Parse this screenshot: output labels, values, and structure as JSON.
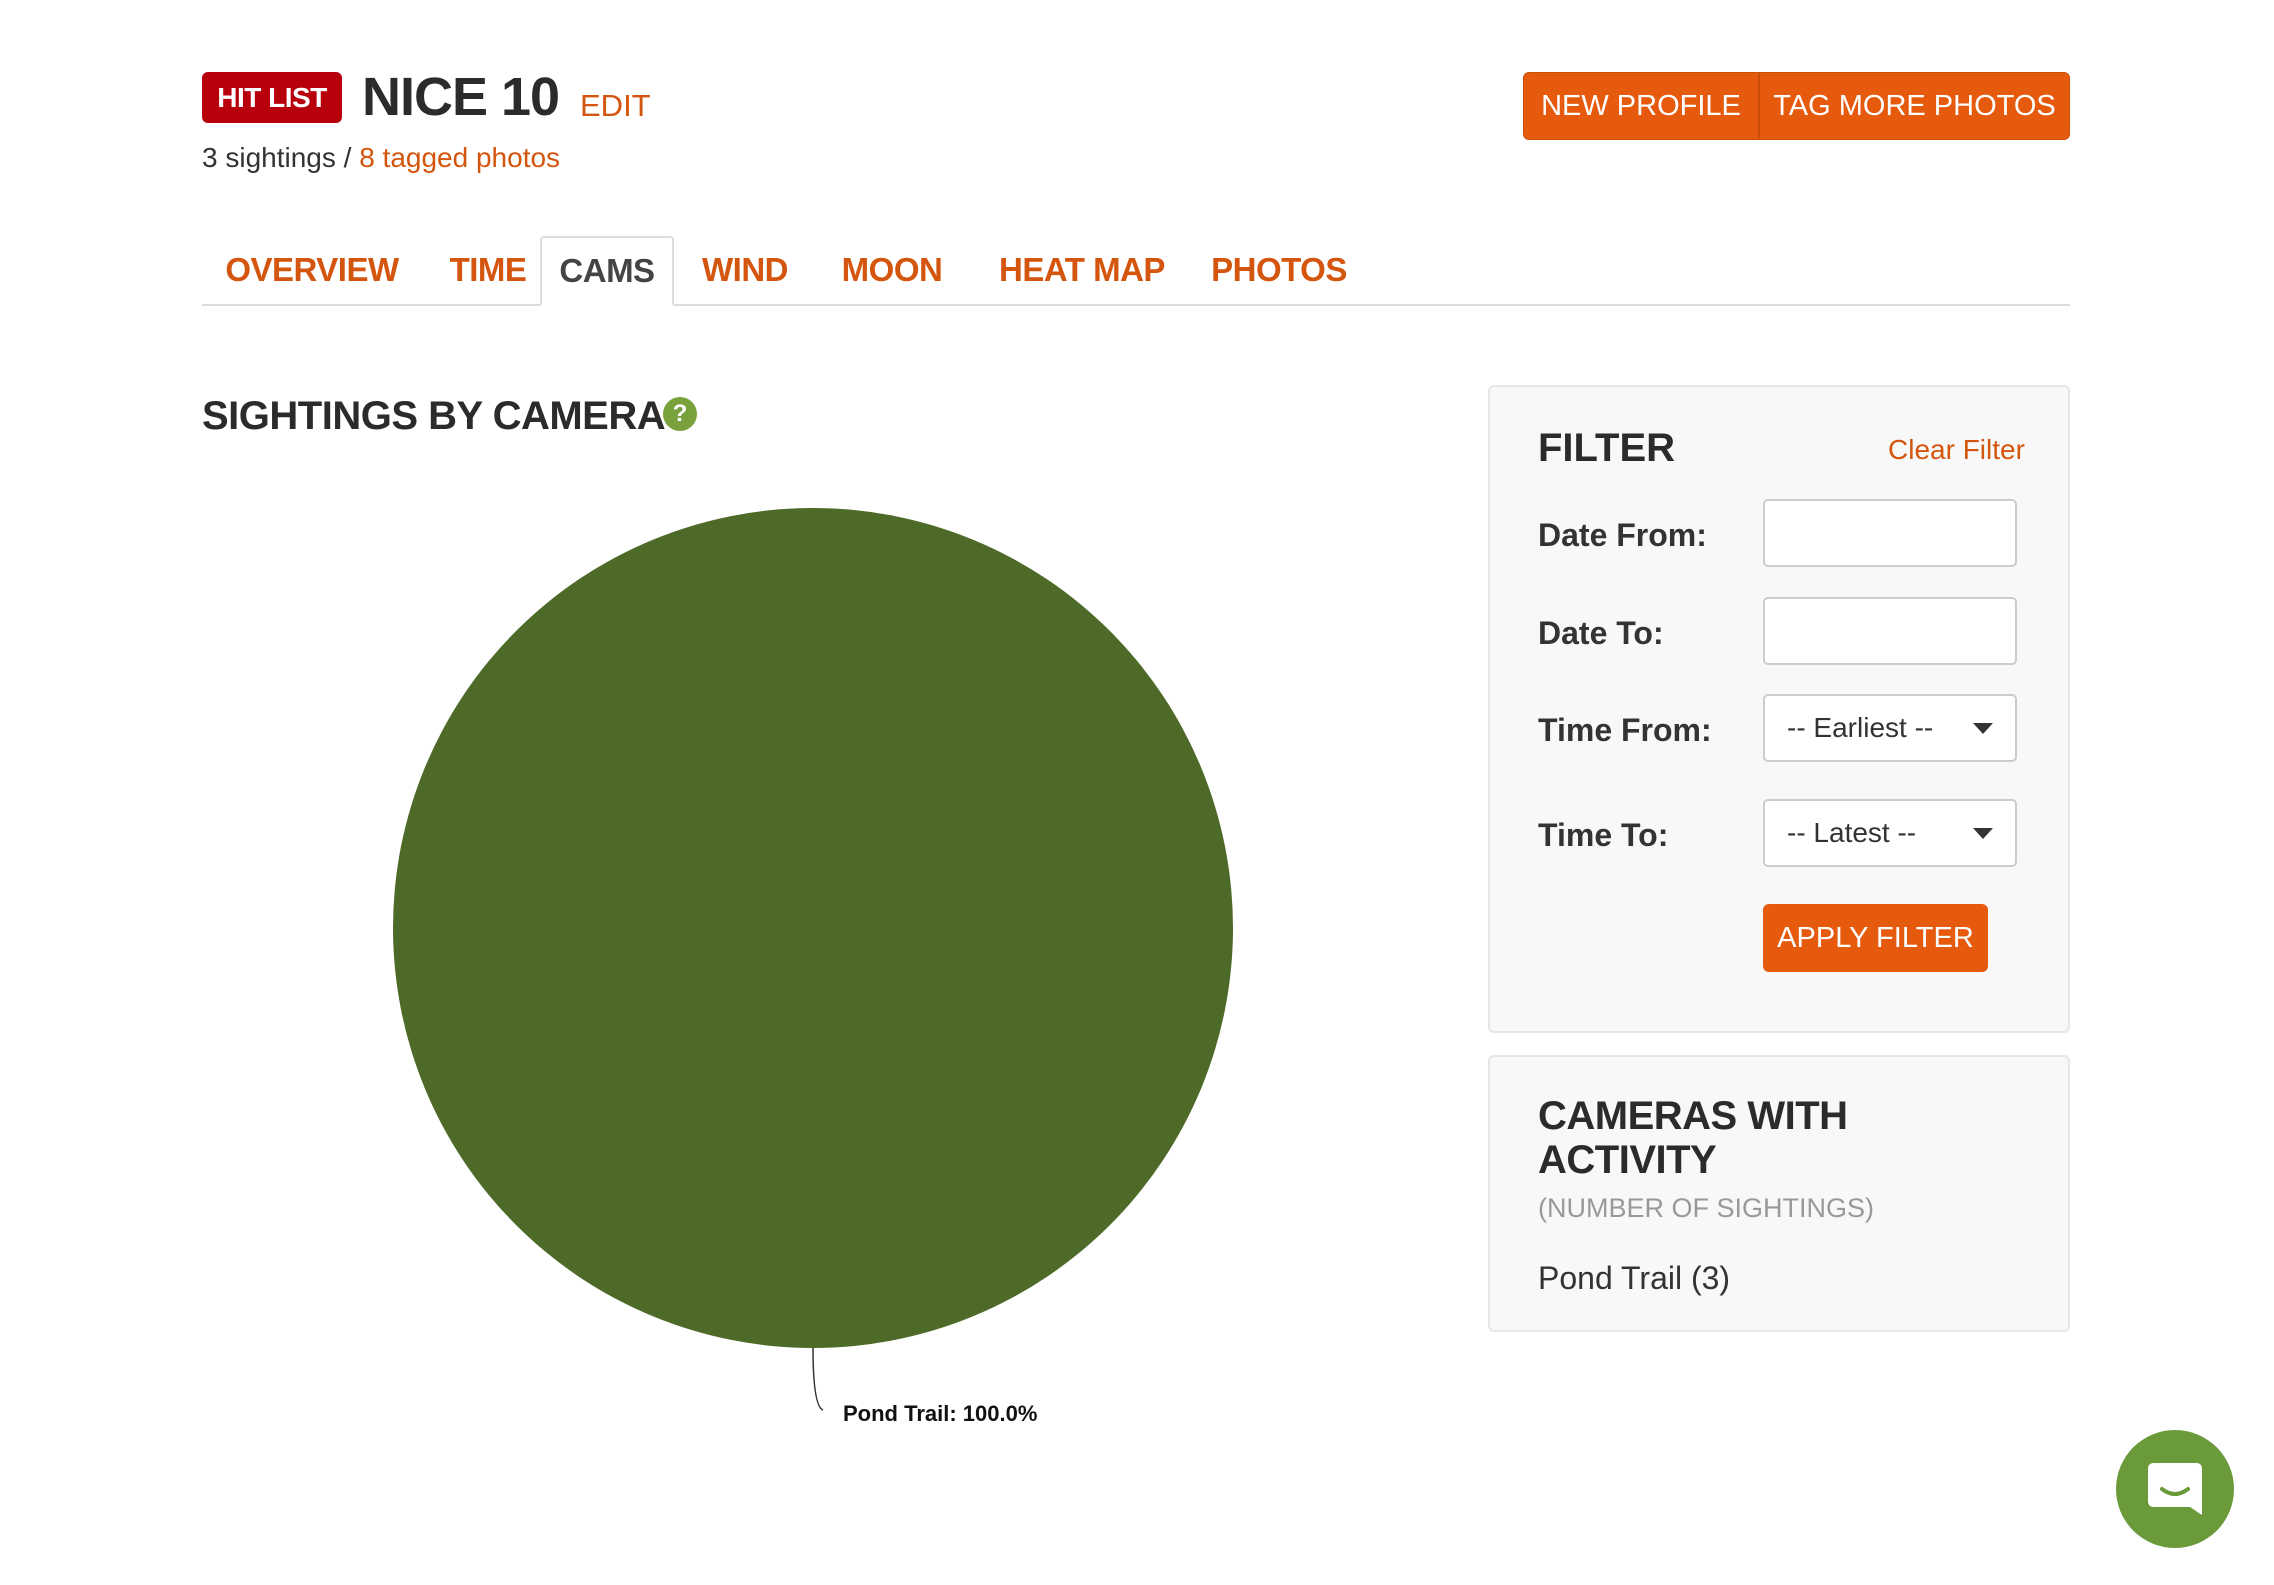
{
  "header": {
    "badge": "HIT LIST",
    "title": "NICE 10",
    "edit_label": "EDIT",
    "sightings_text": "3 sightings / ",
    "tagged_link": "8 tagged photos",
    "new_profile_label": "NEW PROFILE",
    "tag_more_label": "TAG MORE PHOTOS"
  },
  "tabs": [
    {
      "label": "OVERVIEW",
      "active": false
    },
    {
      "label": "TIME",
      "active": false
    },
    {
      "label": "CAMS",
      "active": true
    },
    {
      "label": "WIND",
      "active": false
    },
    {
      "label": "MOON",
      "active": false
    },
    {
      "label": "HEAT MAP",
      "active": false
    },
    {
      "label": "PHOTOS",
      "active": false
    }
  ],
  "section": {
    "title": "SIGHTINGS BY CAMERA",
    "help_icon": "question-circle-icon",
    "help_glyph": "?"
  },
  "chart_data": {
    "type": "pie",
    "slices": [
      {
        "label": "Pond Trail",
        "value": 100.0,
        "display": "Pond Trail: 100.0%",
        "color": "#4e6a28"
      }
    ]
  },
  "filter": {
    "title": "FILTER",
    "clear_label": "Clear Filter",
    "date_from_label": "Date From:",
    "date_from_value": "",
    "date_to_label": "Date To:",
    "date_to_value": "",
    "time_from_label": "Time From:",
    "time_from_value": "-- Earliest --",
    "time_to_label": "Time To:",
    "time_to_value": "-- Latest --",
    "apply_label": "APPLY FILTER"
  },
  "cameras": {
    "title": "CAMERAS WITH ACTIVITY",
    "subtitle": "(NUMBER OF SIGHTINGS)",
    "items": [
      "Pond Trail (3)"
    ]
  },
  "chat": {
    "icon": "chat-bubble-icon"
  },
  "colors": {
    "accent": "#e55a0c",
    "link": "#d4550d",
    "badge": "#b8000d",
    "pie": "#4e6a28",
    "help": "#79a23c",
    "chat": "#6a9a3a"
  }
}
